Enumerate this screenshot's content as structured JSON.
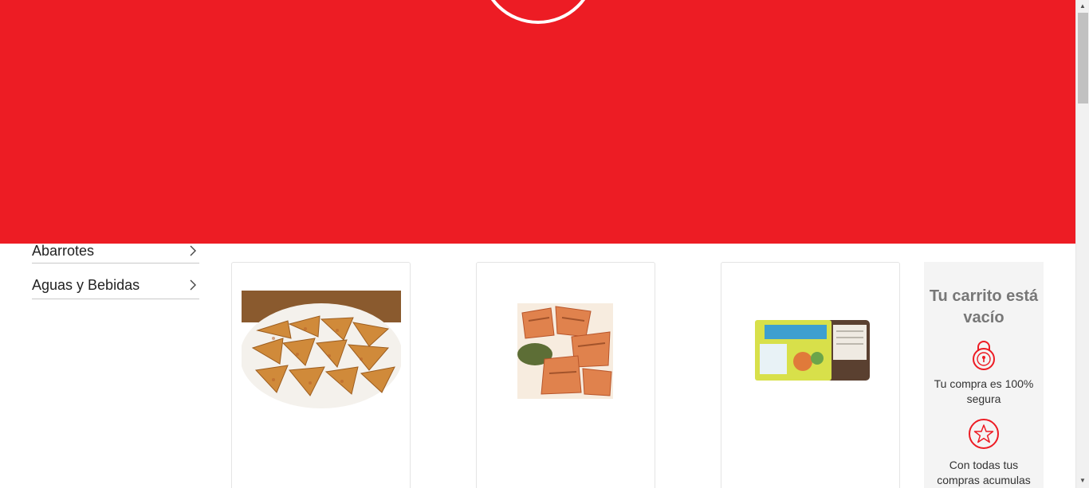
{
  "categories": [
    {
      "label": "Abarrotes"
    },
    {
      "label": "Aguas y Bebidas"
    }
  ],
  "products": [
    {
      "image": "potato-wedges"
    },
    {
      "image": "grilled-chicken"
    },
    {
      "image": "bread-package"
    }
  ],
  "cart": {
    "title": "Tu carrito está vacío",
    "secure_text": "Tu compra es 100% segura",
    "points_text": "Con todas tus compras acumulas"
  },
  "colors": {
    "brand_red": "#ed1c24",
    "panel_bg": "#f4f4f4"
  },
  "icons": [
    "chevron-right-icon",
    "lock-icon",
    "star-icon",
    "scroll-up-arrow",
    "scroll-down-arrow"
  ]
}
